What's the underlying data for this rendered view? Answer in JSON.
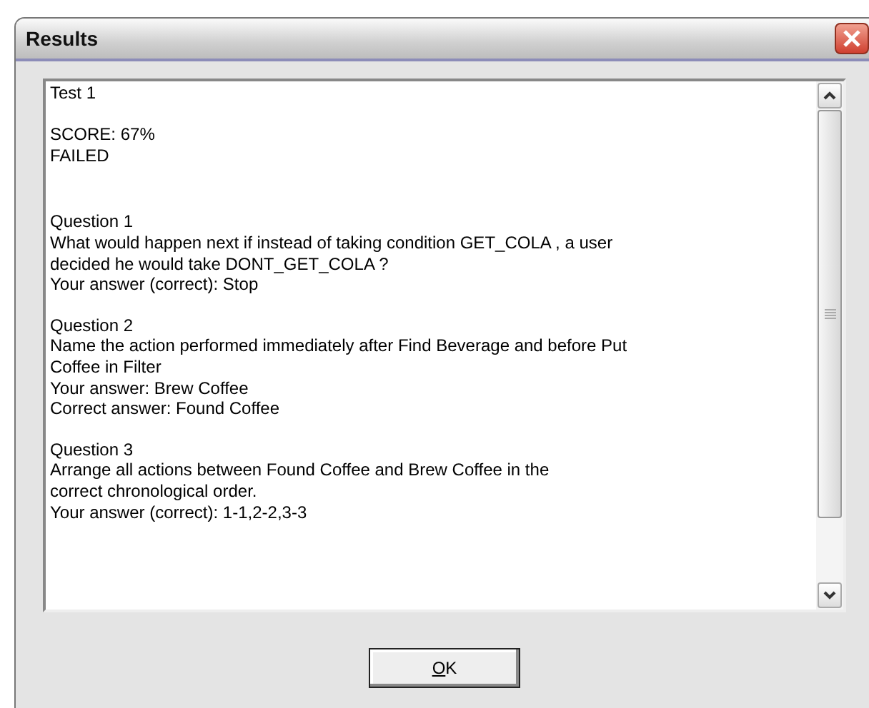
{
  "window": {
    "title": "Results"
  },
  "report": {
    "test": "Test 1",
    "score": "SCORE: 67%",
    "result": "FAILED",
    "questions": [
      {
        "title": "Question 1",
        "lines": [
          "What would happen next if instead of taking condition GET_COLA , a user",
          "decided he would take DONT_GET_COLA ?",
          "Your answer (correct): Stop"
        ]
      },
      {
        "title": "Question 2",
        "lines": [
          "Name the action performed immediately after Find Beverage and before Put",
          "Coffee in Filter",
          "Your answer: Brew Coffee",
          "Correct answer: Found Coffee"
        ]
      },
      {
        "title": "Question 3",
        "lines": [
          "Arrange all actions between Found Coffee and Brew Coffee in the",
          "correct chronological order.",
          "Your answer (correct): 1-1,2-2,3-3"
        ]
      }
    ]
  },
  "ok_button": {
    "label": "OK",
    "mnemonic_underlined": true
  }
}
